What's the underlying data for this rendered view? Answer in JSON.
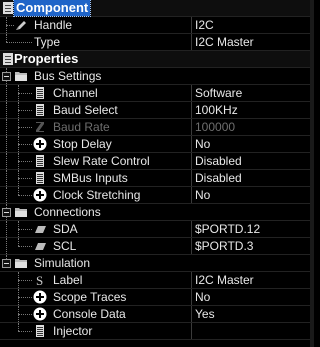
{
  "component": {
    "title": "Component",
    "handle": {
      "label": "Handle",
      "value": "I2C"
    },
    "type": {
      "label": "Type",
      "value": "I2C Master"
    }
  },
  "properties": {
    "title": "Properties",
    "bus_settings": {
      "title": "Bus Settings",
      "channel": {
        "label": "Channel",
        "value": "Software"
      },
      "baud_select": {
        "label": "Baud Select",
        "value": "100KHz"
      },
      "baud_rate": {
        "label": "Baud Rate",
        "value": "100000"
      },
      "stop_delay": {
        "label": "Stop Delay",
        "value": "No"
      },
      "slew_rate": {
        "label": "Slew Rate Control",
        "value": "Disabled"
      },
      "smbus": {
        "label": "SMBus Inputs",
        "value": "Disabled"
      },
      "clock_stretching": {
        "label": "Clock Stretching",
        "value": "No"
      }
    },
    "connections": {
      "title": "Connections",
      "sda": {
        "label": "SDA",
        "value": "$PORTD.12"
      },
      "scl": {
        "label": "SCL",
        "value": "$PORTD.3"
      }
    },
    "simulation": {
      "title": "Simulation",
      "label": {
        "label": "Label",
        "value": "I2C Master"
      },
      "scope_traces": {
        "label": "Scope Traces",
        "value": "No"
      },
      "console_data": {
        "label": "Console Data",
        "value": "Yes"
      },
      "injector": {
        "label": "Injector",
        "value": ""
      }
    }
  },
  "icons": {
    "section": "document-icon",
    "folder": "folder-icon",
    "list": "list-icon",
    "plus": "plus-circle-icon",
    "pen": "pen-icon",
    "pin": "pin-icon",
    "baud": "z-icon",
    "label": "s-icon"
  }
}
